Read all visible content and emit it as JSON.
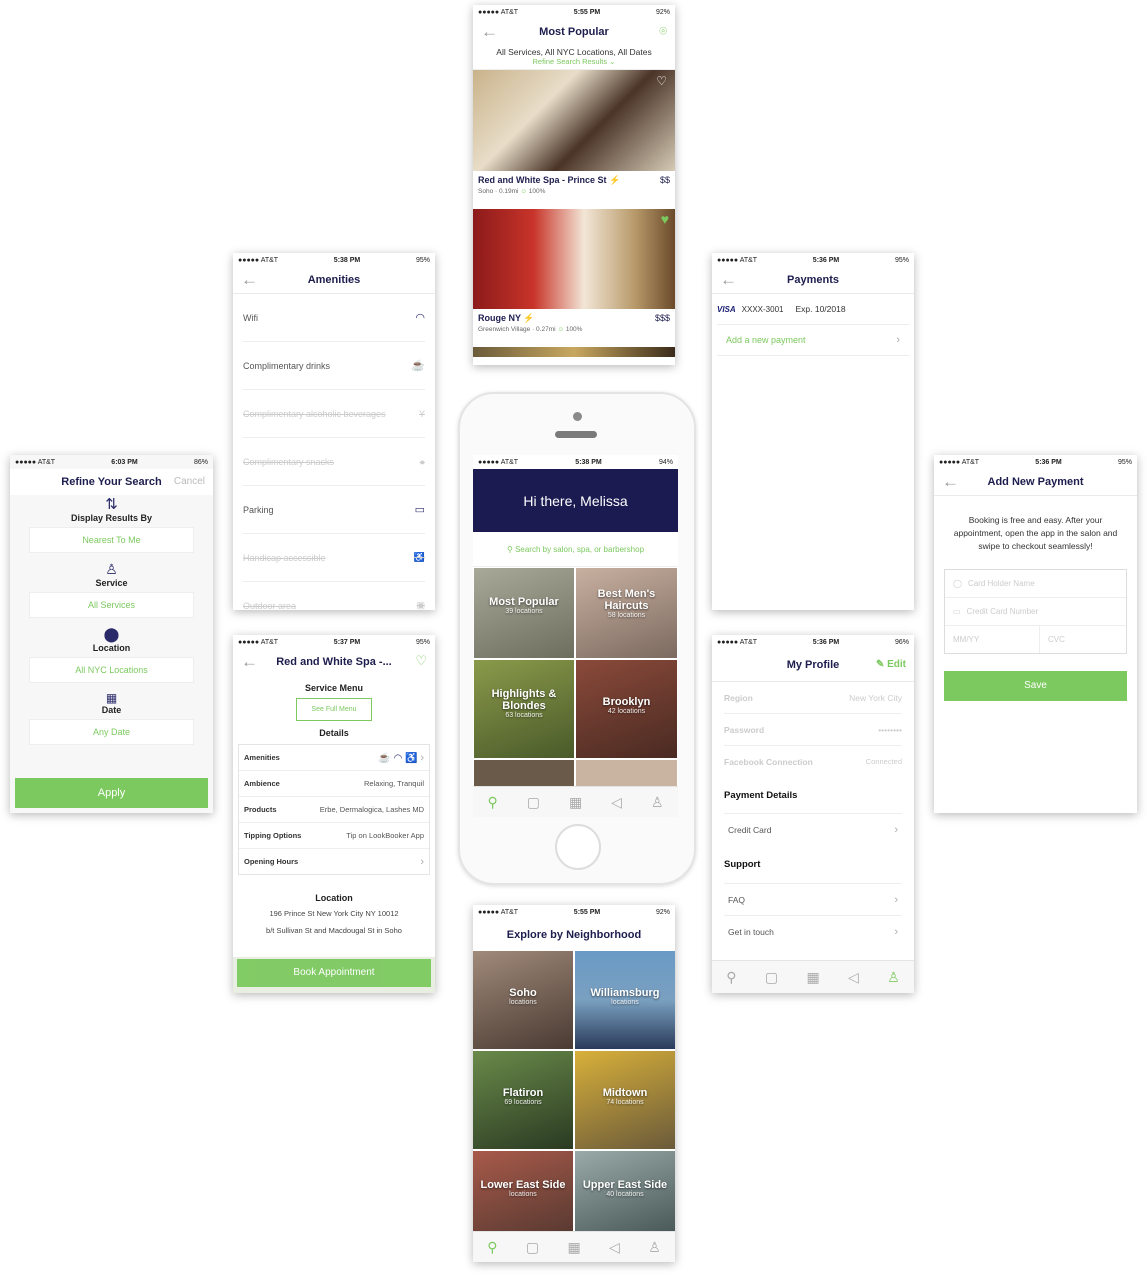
{
  "status": {
    "carrier": "●●●●● AT&T",
    "wifi": "wifi-icon",
    "refine_time": "6:03 PM",
    "refine_batt": "86%",
    "amen_time": "5:38 PM",
    "amen_batt": "95%",
    "popular_time": "5:55 PM",
    "popular_batt": "92%",
    "pay_time": "5:36 PM",
    "pay_batt": "95%",
    "addpay_time": "5:36 PM",
    "addpay_batt": "95%",
    "detail_time": "5:37 PM",
    "detail_batt": "95%",
    "home_time": "5:38 PM",
    "home_batt": "94%",
    "profile_time": "5:36 PM",
    "profile_batt": "96%",
    "explore_time": "5:55 PM",
    "explore_batt": "92%"
  },
  "refine": {
    "title": "Refine Your Search",
    "cancel": "Cancel",
    "display_label": "Display Results By",
    "display_value": "Nearest To Me",
    "service_label": "Service",
    "service_value": "All Services",
    "location_label": "Location",
    "location_value": "All NYC Locations",
    "date_label": "Date",
    "date_value": "Any Date",
    "apply": "Apply"
  },
  "amenities": {
    "title": "Amenities",
    "items": [
      {
        "label": "Wifi",
        "icon": "wifi-icon",
        "enabled": true
      },
      {
        "label": "Complimentary drinks",
        "icon": "coffee-icon",
        "enabled": true
      },
      {
        "label": "Complimentary alcoholic beverages",
        "icon": "wine-icon",
        "enabled": false
      },
      {
        "label": "Complimentary snacks",
        "icon": "snack-icon",
        "enabled": false
      },
      {
        "label": "Parking",
        "icon": "car-icon",
        "enabled": true
      },
      {
        "label": "Handicap accessible",
        "icon": "wheelchair-icon",
        "enabled": false
      },
      {
        "label": "Outdoor area",
        "icon": "outdoor-icon",
        "enabled": false
      }
    ]
  },
  "popular": {
    "title": "Most Popular",
    "filters": "All Services, All NYC Locations, All Dates",
    "refine_link": "Refine Search Results",
    "listings": [
      {
        "name": "Red and White Spa - Prince St",
        "price": "$$",
        "meta": "Soho · 0.19mi",
        "rating": "100%"
      },
      {
        "name": "Rouge NY",
        "price": "$$$",
        "meta": "Greenwich Village · 0.27mi",
        "rating": "100%"
      }
    ]
  },
  "payments": {
    "title": "Payments",
    "card_brand": "VISA",
    "card_number": "XXXX-3001",
    "card_exp": "Exp. 10/2018",
    "add_new": "Add a new payment"
  },
  "add_payment": {
    "title": "Add New Payment",
    "intro": "Booking is free and easy. After your appointment, open the app in the salon and swipe to checkout seamlessly!",
    "card_holder_placeholder": "Card Holder Name",
    "card_number_placeholder": "Credit Card Number",
    "mmyy_placeholder": "MM/YY",
    "cvc_placeholder": "CVC",
    "save": "Save"
  },
  "detail": {
    "title": "Red and White Spa -...",
    "service_menu": "Service Menu",
    "see_full_menu": "See Full Menu",
    "details_label": "Details",
    "rows": [
      {
        "label": "Amenities",
        "value": ""
      },
      {
        "label": "Ambience",
        "value": "Relaxing, Tranquil"
      },
      {
        "label": "Products",
        "value": "Erbe, Dermalogica, Lashes MD"
      },
      {
        "label": "Tipping Options",
        "value": "Tip on LookBooker App"
      },
      {
        "label": "Opening Hours",
        "value": ""
      }
    ],
    "location_label": "Location",
    "address": "196 Prince St New York City NY 10012",
    "cross_streets": "b/t Sullivan St and Macdougal St in Soho",
    "book": "Book Appointment"
  },
  "home": {
    "greeting": "Hi there, Melissa",
    "search_placeholder": "Search by salon, spa, or barbershop",
    "tiles": [
      {
        "title": "Most Popular",
        "sub": "39 locations",
        "color": "#8a8a7a"
      },
      {
        "title": "Best Men's Haircuts",
        "sub": "58 locations",
        "color": "#9c8b80"
      },
      {
        "title": "Highlights & Blondes",
        "sub": "63 locations",
        "color": "#6b7a3a"
      },
      {
        "title": "Brooklyn",
        "sub": "42 locations",
        "color": "#6a3b32"
      }
    ]
  },
  "profile": {
    "title": "My Profile",
    "edit": "Edit",
    "region_label": "Region",
    "region_value": "New York City",
    "password_label": "Password",
    "password_value": "••••••••",
    "facebook_label": "Facebook Connection",
    "facebook_value": "Connected",
    "payment_details": "Payment Details",
    "credit_card": "Credit Card",
    "support": "Support",
    "faq": "FAQ",
    "get_in_touch": "Get in touch"
  },
  "explore": {
    "title": "Explore by Neighborhood",
    "tiles": [
      {
        "title": "Soho",
        "sub": "locations",
        "color": "#6f5f55"
      },
      {
        "title": "Williamsburg",
        "sub": "locations",
        "color": "#5a7ea6"
      },
      {
        "title": "Flatiron",
        "sub": "69 locations",
        "color": "#4f6b3e"
      },
      {
        "title": "Midtown",
        "sub": "74 locations",
        "color": "#b89a2e"
      },
      {
        "title": "Lower East Side",
        "sub": "locations",
        "color": "#8a4a3e"
      },
      {
        "title": "Upper East Side",
        "sub": "40 locations",
        "color": "#7a8a88"
      }
    ]
  },
  "colors": {
    "accent": "#7cc95f",
    "navy": "#1d1d4e"
  }
}
